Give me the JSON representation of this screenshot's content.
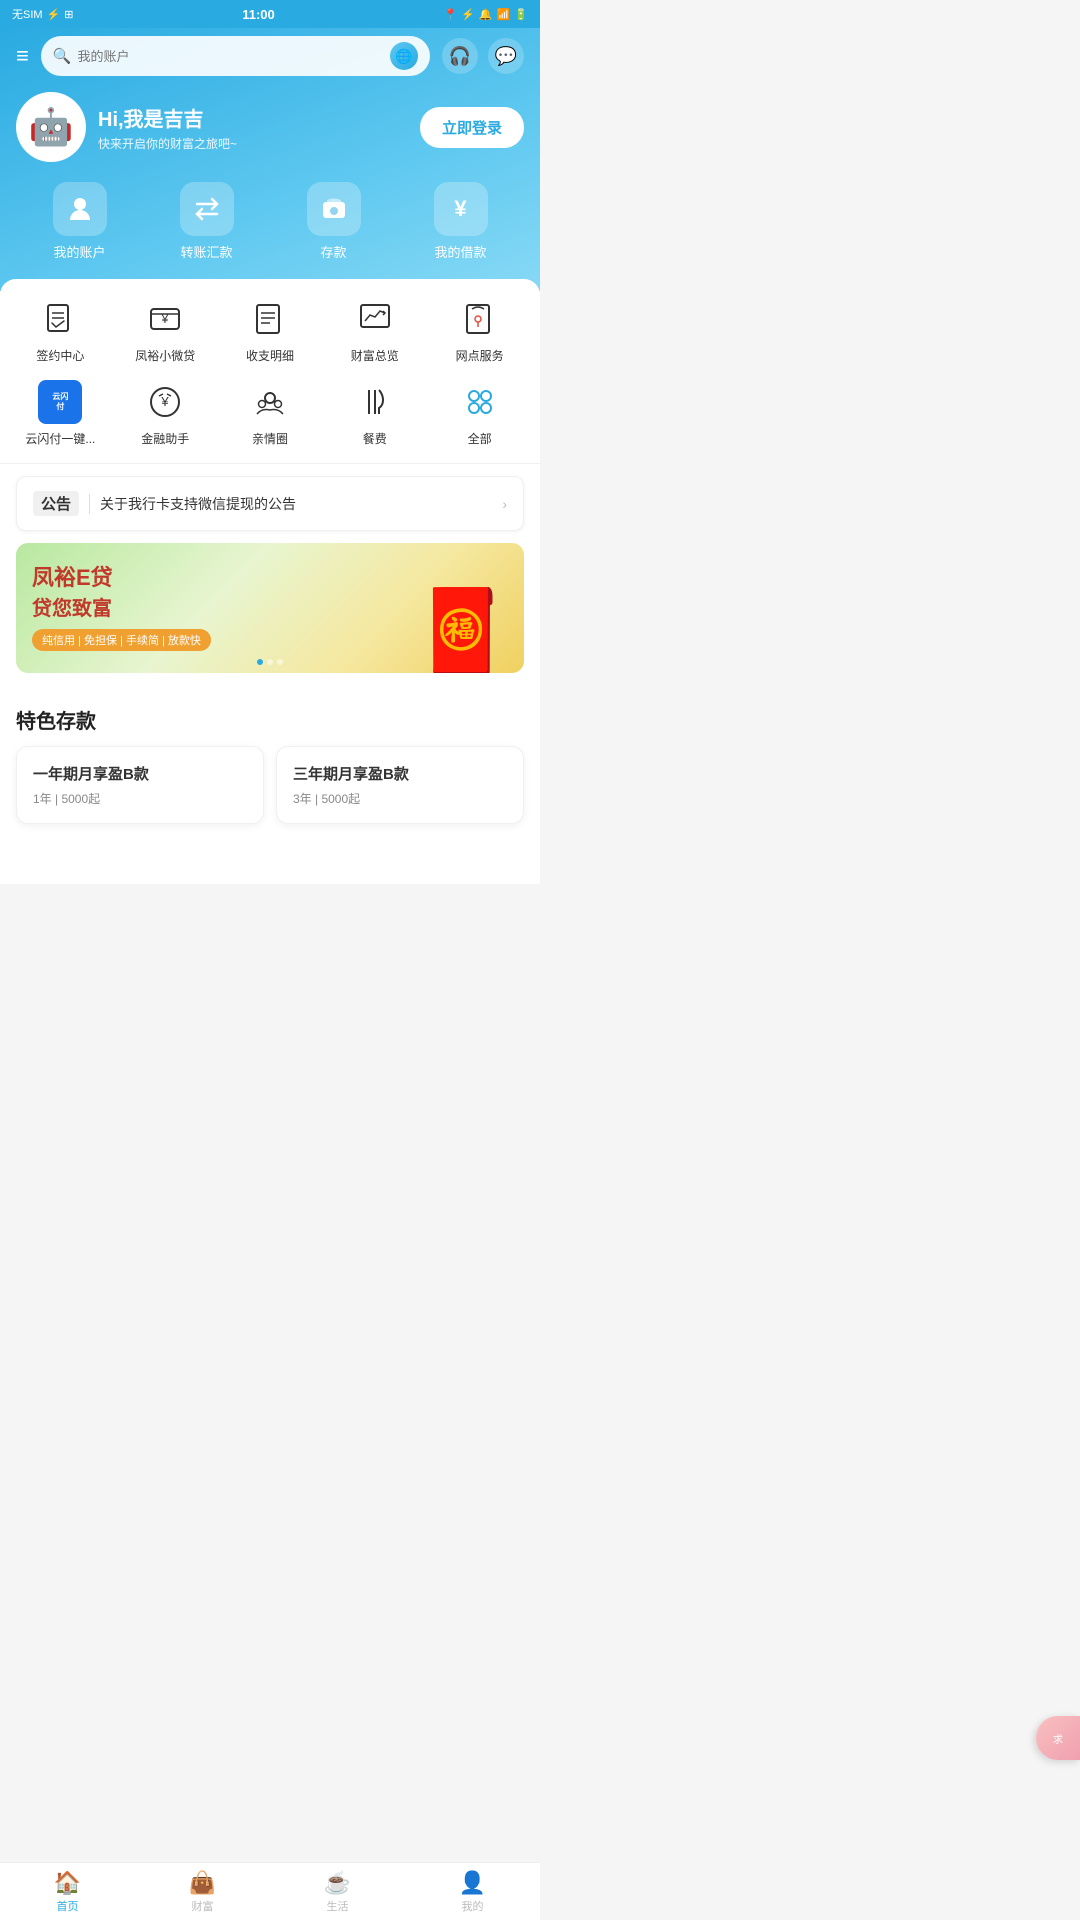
{
  "statusBar": {
    "left": "无SIM ψ",
    "time": "11:00",
    "right": "🔋"
  },
  "header": {
    "searchPlaceholder": "我的账户",
    "greetingTitle": "Hi,我是吉吉",
    "greetingSub": "快来开启你的财富之旅吧~",
    "loginLabel": "立即登录",
    "robotEmoji": "🤖"
  },
  "quickNav": [
    {
      "label": "我的账户",
      "icon": "👤"
    },
    {
      "label": "转账汇款",
      "icon": "⇄"
    },
    {
      "label": "存款",
      "icon": "👛"
    },
    {
      "label": "我的借款",
      "icon": "¥"
    }
  ],
  "services1": [
    {
      "label": "签约中心",
      "icon": "📝"
    },
    {
      "label": "凤裕小微贷",
      "icon": "💴"
    },
    {
      "label": "收支明细",
      "icon": "📋"
    },
    {
      "label": "财富总览",
      "icon": "📈"
    },
    {
      "label": "网点服务",
      "icon": "📖"
    }
  ],
  "services2": [
    {
      "label": "云闪付一键...",
      "icon": "yunshan"
    },
    {
      "label": "金融助手",
      "icon": "🪙"
    },
    {
      "label": "亲情圈",
      "icon": "👨‍👩‍👧"
    },
    {
      "label": "餐费",
      "icon": "🍴"
    },
    {
      "label": "全部",
      "icon": "⬡"
    }
  ],
  "notice": {
    "label": "公告",
    "text": "关于我行卡支持微信提现的公告"
  },
  "banner": {
    "title": "凤裕E贷",
    "subtitle": "贷您致富",
    "tags": "纯信用 | 免担保 | 手续简 | 放款快",
    "dots": [
      true,
      false,
      false
    ]
  },
  "specialDeposit": {
    "sectionTitle": "特色存款",
    "cards": [
      {
        "title": "一年期月享盈B款",
        "info": "1年 | 5000起"
      },
      {
        "title": "三年期月享盈B款",
        "info": "3年 | 5000起"
      }
    ]
  },
  "floatBtn": {
    "label": "求"
  },
  "bottomNav": [
    {
      "label": "首页",
      "active": true,
      "icon": "🏠"
    },
    {
      "label": "财富",
      "active": false,
      "icon": "👜"
    },
    {
      "label": "生活",
      "active": false,
      "icon": "☕"
    },
    {
      "label": "我的",
      "active": false,
      "icon": "👤"
    }
  ]
}
